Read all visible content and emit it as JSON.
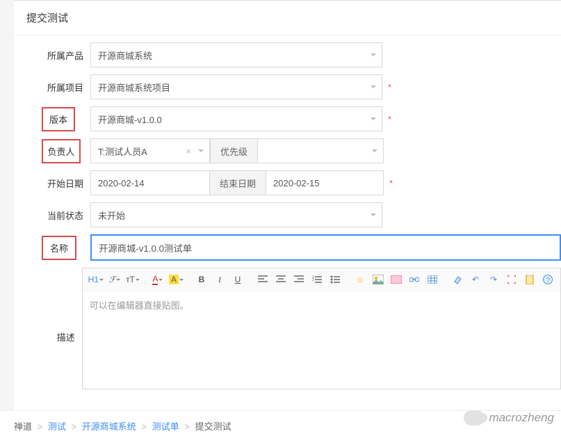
{
  "page_title": "提交测试",
  "labels": {
    "product": "所属产品",
    "project": "所属项目",
    "version": "版本",
    "owner": "负责人",
    "priority": "优先级",
    "start_date": "开始日期",
    "end_date": "结束日期",
    "status": "当前状态",
    "name": "名称",
    "description": "描述"
  },
  "values": {
    "product": "开源商城系统",
    "project": "开源商城系统项目",
    "version": "开源商城-v1.0.0",
    "owner": "T:测试人员A",
    "priority": "",
    "start_date": "2020-02-14",
    "end_date": "2020-02-15",
    "status": "未开始",
    "name": "开源商城-v1.0.0测试单"
  },
  "editor_placeholder": "可以在编辑器直接贴图。",
  "toolbar": {
    "h1": "H1",
    "font": "ℱ",
    "size": "ᴛT",
    "color": "A",
    "bg": "A",
    "bold": "B",
    "italic": "I",
    "underline": "U",
    "emoji": "☺"
  },
  "breadcrumb": {
    "home": "禅道",
    "test": "测试",
    "product": "开源商城系统",
    "module": "测试单",
    "current": "提交测试"
  },
  "watermark": "macrozheng"
}
